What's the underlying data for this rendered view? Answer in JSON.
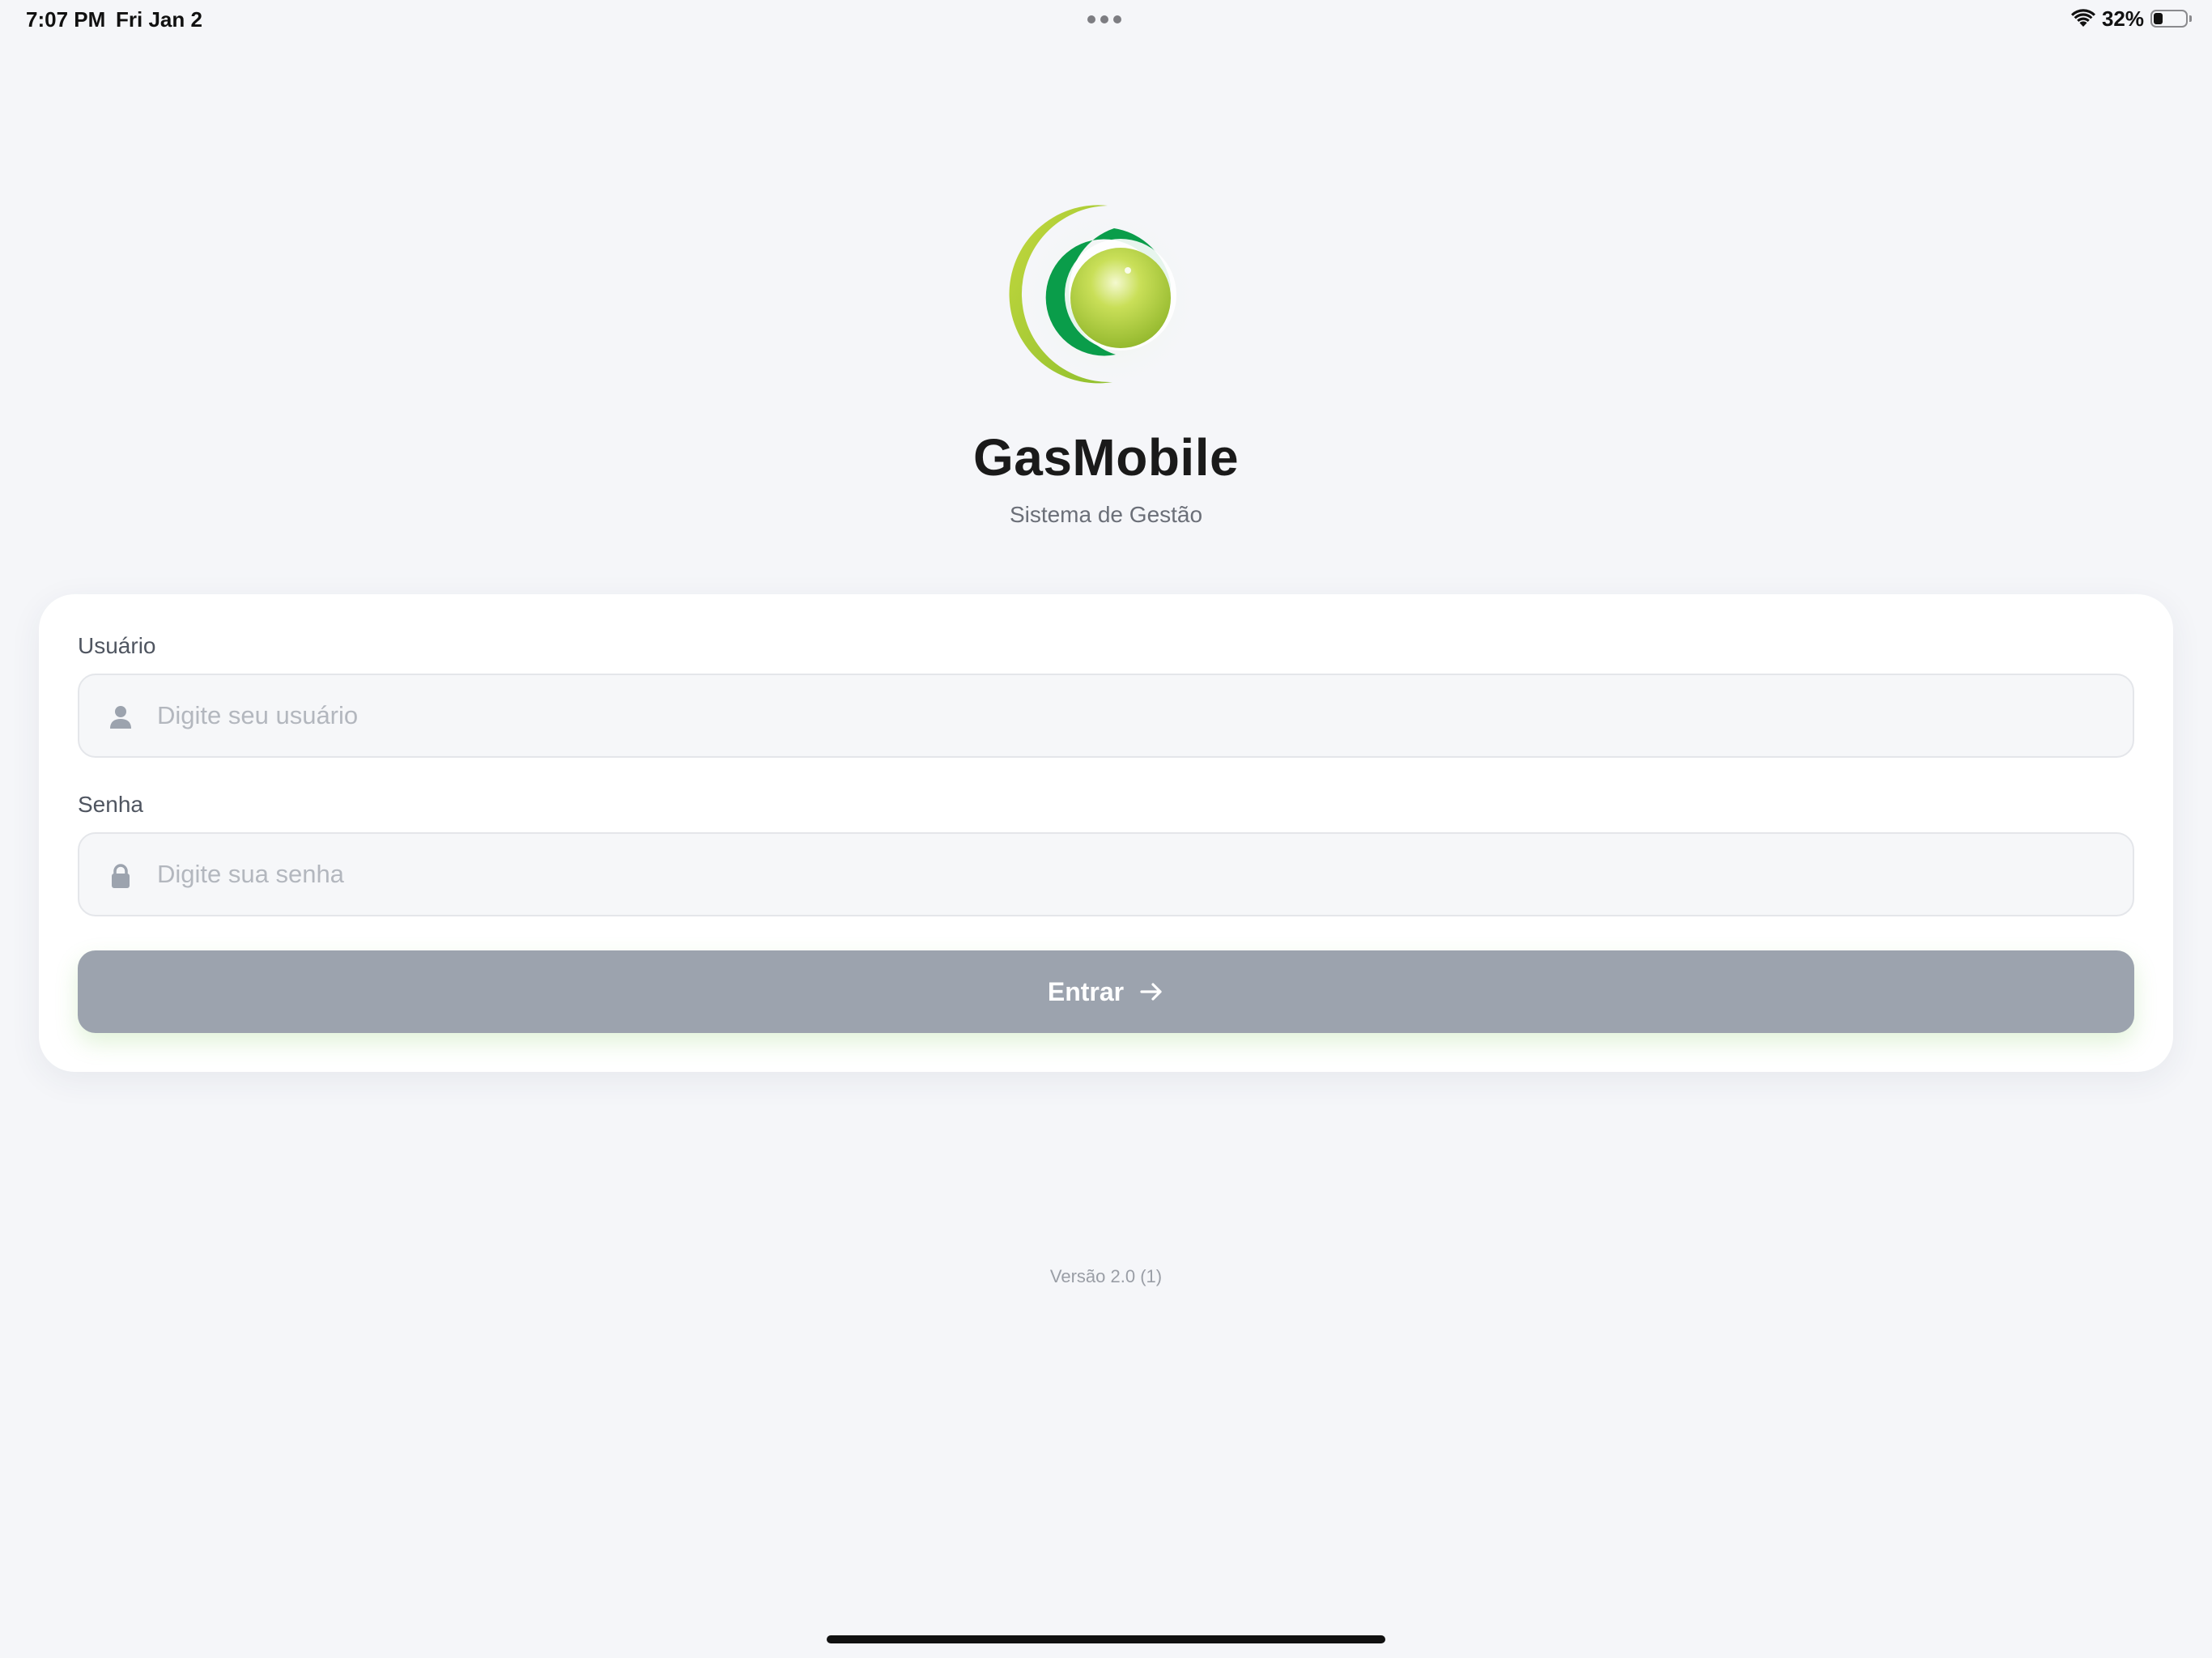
{
  "status_bar": {
    "time": "7:07 PM",
    "date": "Fri Jan 2",
    "battery_percent": "32%",
    "battery_level": 0.32
  },
  "app": {
    "title": "GasMobile",
    "subtitle": "Sistema de Gestão",
    "logo_icon": "gasmobile-logo",
    "brand_colors": {
      "dark_green": "#0a9d4a",
      "lime_green": "#a8c833"
    }
  },
  "login_form": {
    "username_label": "Usuário",
    "username_placeholder": "Digite seu usuário",
    "username_value": "",
    "username_icon": "user-icon",
    "password_label": "Senha",
    "password_placeholder": "Digite sua senha",
    "password_value": "",
    "password_icon": "lock-icon",
    "submit_label": "Entrar",
    "submit_icon": "arrow-right-icon",
    "submit_color": "#9ca3ae"
  },
  "footer": {
    "version": "Versão 2.0 (1)"
  }
}
